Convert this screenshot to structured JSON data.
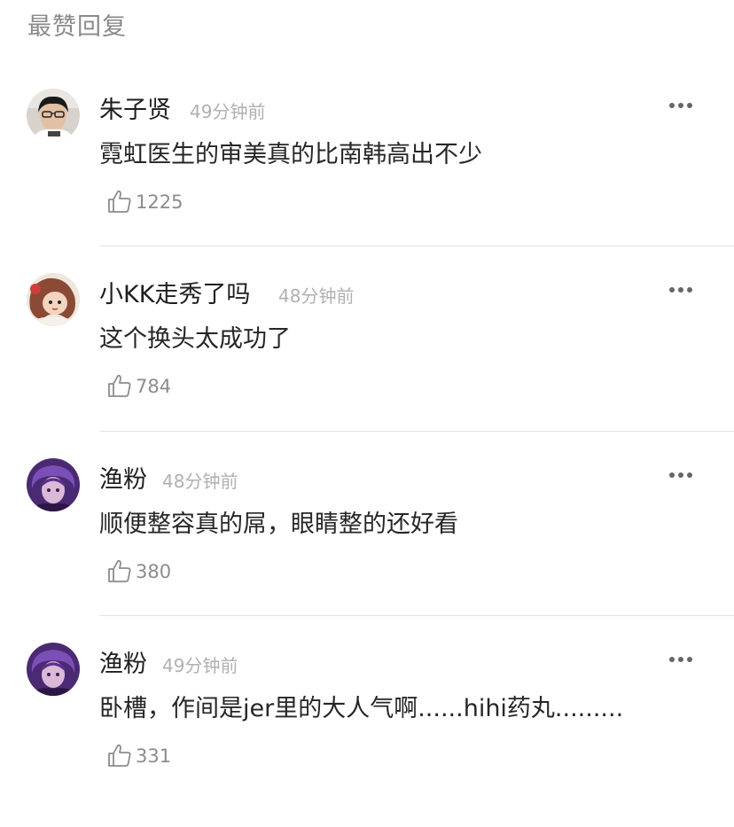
{
  "section": {
    "title": "最赞回复"
  },
  "comments": [
    {
      "author": "朱子贤",
      "time": "49分钟前",
      "text": "霓虹医生的审美真的比南韩高出不少",
      "likes": "1225",
      "avatar": "man-with-glasses-avatar"
    },
    {
      "author": "小KK走秀了吗",
      "time": "48分钟前",
      "text": "这个换头太成功了",
      "likes": "784",
      "avatar": "cartoon-girl-avatar"
    },
    {
      "author": "渔粉",
      "time": "48分钟前",
      "text": "顺便整容真的屌，眼睛整的还好看",
      "likes": "380",
      "avatar": "purple-game-character-avatar"
    },
    {
      "author": "渔粉",
      "time": "49分钟前",
      "text": "卧槽，作间是jer里的大人气啊......hihi药丸.........",
      "likes": "331",
      "avatar": "purple-game-character-avatar"
    }
  ],
  "colors": {
    "title": "#8a8a8a",
    "author": "#1e1e1e",
    "time": "#b0b0b0",
    "like": "#8c8c8c",
    "divider": "#e3e3e3"
  },
  "icons": {
    "like": "thumbs-up-outline-icon",
    "more": "more-dots-icon"
  }
}
